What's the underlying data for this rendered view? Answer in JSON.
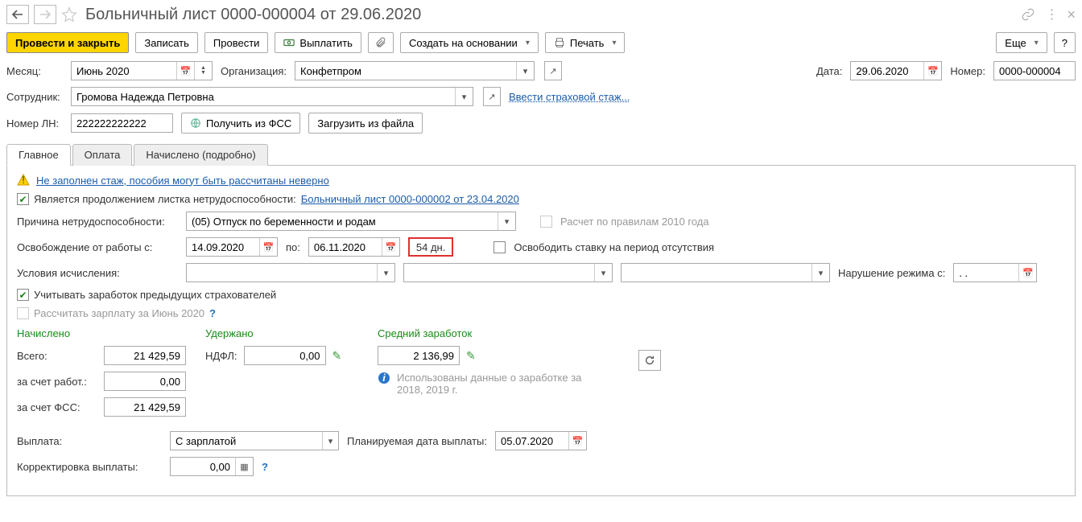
{
  "title": "Больничный лист 0000-000004 от 29.06.2020",
  "toolbar": {
    "post_and_close": "Провести и закрыть",
    "save": "Записать",
    "post": "Провести",
    "pay": "Выплатить",
    "create_based": "Создать на основании",
    "print": "Печать",
    "more": "Еще"
  },
  "header": {
    "month_label": "Месяц:",
    "month_value": "Июнь 2020",
    "org_label": "Организация:",
    "org_value": "Конфетпром",
    "date_label": "Дата:",
    "date_value": "29.06.2020",
    "number_label": "Номер:",
    "number_value": "0000-000004",
    "employee_label": "Сотрудник:",
    "employee_value": "Громова Надежда Петровна",
    "insurance_link": "Ввести страховой стаж...",
    "ln_label": "Номер ЛН:",
    "ln_value": "222222222222",
    "fss_btn": "Получить из ФСС",
    "load_file_btn": "Загрузить из файла"
  },
  "tabs": {
    "main": "Главное",
    "payment": "Оплата",
    "accrued": "Начислено (подробно)"
  },
  "main_tab": {
    "warning": "Не заполнен стаж, пособия могут быть рассчитаны неверно",
    "continuation_label": "Является продолжением листка нетрудоспособности:",
    "continuation_link": "Больничный лист 0000-000002 от 23.04.2020",
    "reason_label": "Причина нетрудоспособности:",
    "reason_value": "(05) Отпуск по беременности и родам",
    "rule2010": "Расчет по правилам 2010 года",
    "release_rate": "Освободить ставку на период отсутствия",
    "leave_from_label": "Освобождение от работы с:",
    "leave_from": "14.09.2020",
    "leave_to_label": "по:",
    "leave_to": "06.11.2020",
    "days": "54 дн.",
    "conditions_label": "Условия исчисления:",
    "violation_label": "Нарушение режима с:",
    "violation_value": ". .",
    "consider_prev": "Учитывать заработок предыдущих страхователей",
    "recalc_salary": "Рассчитать зарплату за Июнь 2020",
    "accrued_head": "Начислено",
    "withheld_head": "Удержано",
    "avg_head": "Средний заработок",
    "total_label": "Всего:",
    "total_value": "21 429,59",
    "ndfl_label": "НДФЛ:",
    "ndfl_value": "0,00",
    "avg_value": "2 136,99",
    "employer_label": "за счет работ.:",
    "employer_value": "0,00",
    "fss_label": "за счет ФСС:",
    "fss_value": "21 429,59",
    "info_text": "Использованы данные о заработке за 2018,  2019 г.",
    "payout_label": "Выплата:",
    "payout_value": "С зарплатой",
    "planned_date_label": "Планируемая дата выплаты:",
    "planned_date_value": "05.07.2020",
    "correction_label": "Корректировка выплаты:",
    "correction_value": "0,00"
  }
}
